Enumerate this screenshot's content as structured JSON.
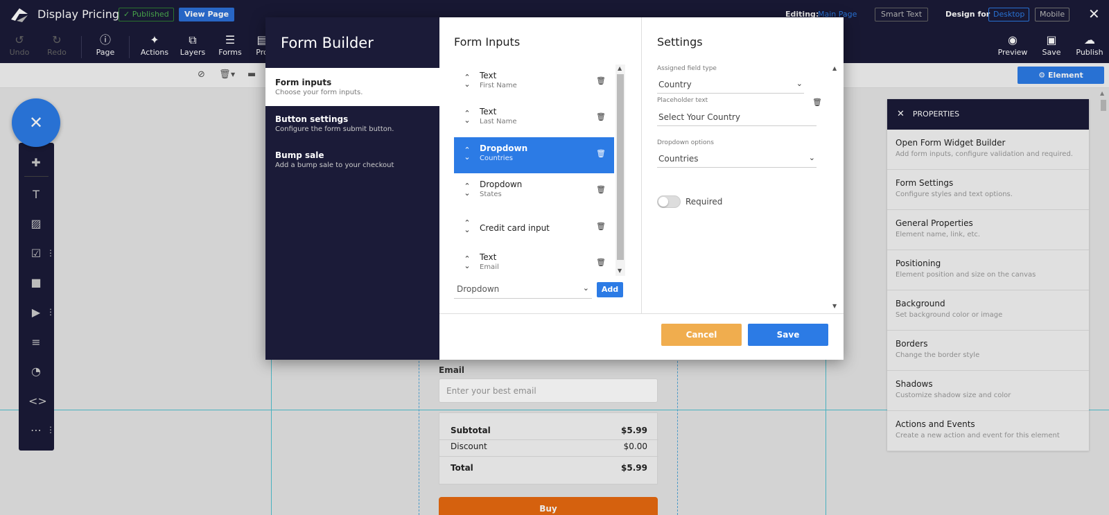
{
  "app": {
    "title": "Display Pricing",
    "published_badge": "✓ Published",
    "view_page": "View Page",
    "editing_label": "Editing:",
    "editing_value": "Main Page",
    "smart_text": "Smart Text",
    "design_for_label": "Design for",
    "desktop": "Desktop",
    "mobile": "Mobile",
    "close": "✕"
  },
  "toolbar": {
    "undo": "Undo",
    "redo": "Redo",
    "page": "Page",
    "actions": "Actions",
    "layers": "Layers",
    "forms": "Forms",
    "products": "Pro",
    "preview": "Preview",
    "save": "Save",
    "publish": "Publish"
  },
  "subtoolbar": {
    "element_properties": "⚙ Element Properties"
  },
  "canvas": {
    "email_label": "Email",
    "email_placeholder": "Enter your best email",
    "summary": [
      {
        "label": "Subtotal",
        "value": "$5.99"
      },
      {
        "label": "Discount",
        "value": "$0.00"
      },
      {
        "label": "Total",
        "value": "$5.99"
      }
    ],
    "buy_label": "Buy"
  },
  "properties": {
    "header": "PROPERTIES",
    "items": [
      {
        "title": "Open Form Widget Builder",
        "sub": "Add form inputs, configure validation and required."
      },
      {
        "title": "Form Settings",
        "sub": "Configure styles and text options."
      },
      {
        "title": "General Properties",
        "sub": "Element name, link, etc."
      },
      {
        "title": "Positioning",
        "sub": "Element position and size on the canvas"
      },
      {
        "title": "Background",
        "sub": "Set background color or image"
      },
      {
        "title": "Borders",
        "sub": "Change the border style"
      },
      {
        "title": "Shadows",
        "sub": "Customize shadow size and color"
      },
      {
        "title": "Actions and Events",
        "sub": "Create a new action and event for this element"
      }
    ]
  },
  "modal": {
    "title": "Form Builder",
    "nav": [
      {
        "title": "Form inputs",
        "sub": "Choose your form inputs."
      },
      {
        "title": "Button settings",
        "sub": "Configure the form submit button."
      },
      {
        "title": "Bump sale",
        "sub": "Add a bump sale to your checkout"
      }
    ],
    "inputs_title": "Form Inputs",
    "inputs": [
      {
        "type": "Text",
        "name": "First Name"
      },
      {
        "type": "Text",
        "name": "Last Name"
      },
      {
        "type": "Dropdown",
        "name": "Countries"
      },
      {
        "type": "Dropdown",
        "name": "States"
      },
      {
        "type": "Credit card input",
        "name": ""
      },
      {
        "type": "Text",
        "name": "Email"
      }
    ],
    "add_select_value": "Dropdown",
    "add_button": "Add",
    "settings_title": "Settings",
    "settings": {
      "field_type_label": "Assigned field type",
      "field_type_value": "Country",
      "placeholder_label": "Placeholder text",
      "placeholder_value": "Select Your Country",
      "options_label": "Dropdown options",
      "options_value": "Countries",
      "required_label": "Required",
      "required": false
    },
    "cancel": "Cancel",
    "save": "Save"
  },
  "colors": {
    "navy": "#1b1b38",
    "accent": "#2c7be5",
    "cancel": "#f0ad4e",
    "buy": "#e86a10"
  }
}
